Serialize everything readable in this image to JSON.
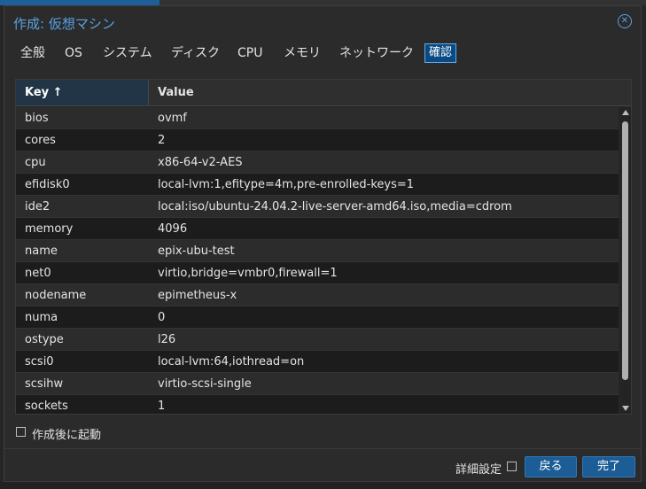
{
  "dialog": {
    "title": "作成: 仮想マシン",
    "close_icon": "close-circle-icon"
  },
  "tabs": [
    {
      "label": "全般"
    },
    {
      "label": "OS"
    },
    {
      "label": "システム"
    },
    {
      "label": "ディスク"
    },
    {
      "label": "CPU"
    },
    {
      "label": "メモリ"
    },
    {
      "label": "ネットワーク"
    },
    {
      "label": "確認",
      "active": true
    }
  ],
  "grid": {
    "columns": {
      "key": "Key ↑",
      "value": "Value"
    },
    "rows": [
      {
        "key": "bios",
        "value": "ovmf"
      },
      {
        "key": "cores",
        "value": "2"
      },
      {
        "key": "cpu",
        "value": "x86-64-v2-AES"
      },
      {
        "key": "efidisk0",
        "value": "local-lvm:1,efitype=4m,pre-enrolled-keys=1"
      },
      {
        "key": "ide2",
        "value": "local:iso/ubuntu-24.04.2-live-server-amd64.iso,media=cdrom"
      },
      {
        "key": "memory",
        "value": "4096"
      },
      {
        "key": "name",
        "value": "epix-ubu-test"
      },
      {
        "key": "net0",
        "value": "virtio,bridge=vmbr0,firewall=1"
      },
      {
        "key": "nodename",
        "value": "epimetheus-x"
      },
      {
        "key": "numa",
        "value": "0"
      },
      {
        "key": "ostype",
        "value": "l26"
      },
      {
        "key": "scsi0",
        "value": "local-lvm:64,iothread=on"
      },
      {
        "key": "scsihw",
        "value": "virtio-scsi-single"
      },
      {
        "key": "sockets",
        "value": "1"
      }
    ]
  },
  "start_after_created": {
    "label": "作成後に起動",
    "checked": false
  },
  "footer": {
    "advanced_label": "詳細設定",
    "advanced_checked": false,
    "back_label": "戻る",
    "finish_label": "完了"
  },
  "colors": {
    "accent": "#5aa1e3",
    "button": "#1d5d96",
    "active_tab": "#0a4a82"
  }
}
